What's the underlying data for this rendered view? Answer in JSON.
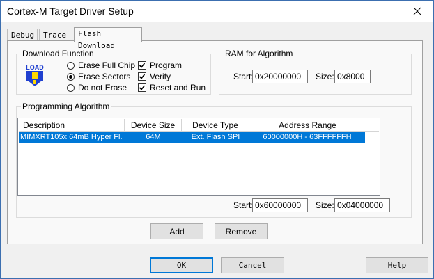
{
  "window": {
    "title": "Cortex-M Target Driver Setup"
  },
  "tabs": [
    {
      "label": "Debug"
    },
    {
      "label": "Trace"
    },
    {
      "label": "Flash Download"
    }
  ],
  "download_function": {
    "legend": "Download Function",
    "icon_text": "LOAD",
    "erase_options": [
      {
        "label": "Erase Full Chip",
        "selected": false
      },
      {
        "label": "Erase Sectors",
        "selected": true
      },
      {
        "label": "Do not Erase",
        "selected": false
      }
    ],
    "checkboxes": [
      {
        "label": "Program",
        "checked": true
      },
      {
        "label": "Verify",
        "checked": true
      },
      {
        "label": "Reset and Run",
        "checked": true
      }
    ]
  },
  "ram_for_algorithm": {
    "legend": "RAM for Algorithm",
    "start_label": "Start:",
    "start_value": "0x20000000",
    "size_label": "Size:",
    "size_value": "0x8000"
  },
  "programming_algorithm": {
    "legend": "Programming Algorithm",
    "columns": [
      "Description",
      "Device Size",
      "Device Type",
      "Address Range"
    ],
    "rows": [
      {
        "description": "MIMXRT105x 64mB Hyper Fl...",
        "device_size": "64M",
        "device_type": "Ext. Flash SPI",
        "address_range": "60000000H - 63FFFFFFH"
      }
    ],
    "start_label": "Start:",
    "start_value": "0x60000000",
    "size_label": "Size:",
    "size_value": "0x04000000",
    "add_label": "Add",
    "remove_label": "Remove"
  },
  "footer": {
    "ok_label": "OK",
    "cancel_label": "Cancel",
    "help_label": "Help"
  },
  "colors": {
    "selection": "#0078d7",
    "focus_border": "#0078d7",
    "window_border": "#3c6fb0",
    "icon_blue": "#2040d0",
    "icon_yellow": "#ffd800"
  }
}
